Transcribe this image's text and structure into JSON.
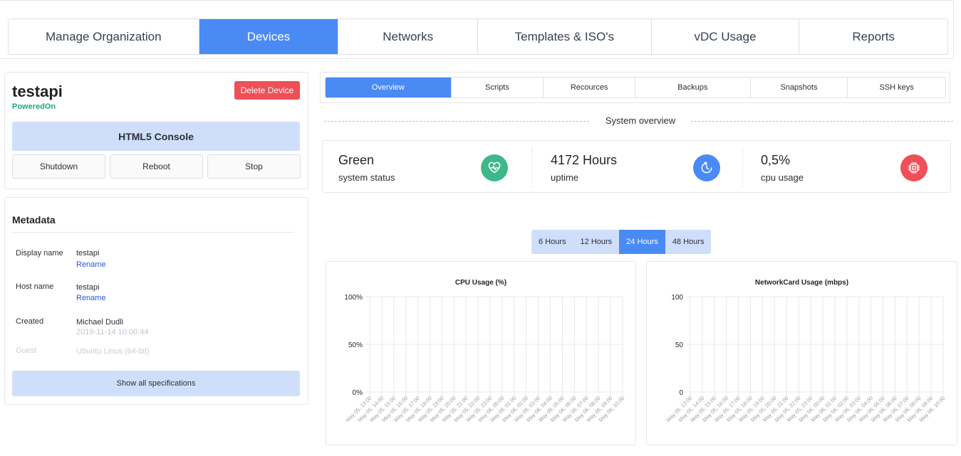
{
  "topnav": {
    "tabs": [
      "Manage Organization",
      "Devices",
      "Networks",
      "Templates & ISO's",
      "vDC Usage",
      "Reports"
    ],
    "active": "Devices"
  },
  "device": {
    "name": "testapi",
    "status": "PoweredOn",
    "delete_label": "Delete Device",
    "console_label": "HTML5 Console",
    "shutdown_label": "Shutdown",
    "reboot_label": "Reboot",
    "stop_label": "Stop"
  },
  "metadata": {
    "title": "Metadata",
    "rows": [
      {
        "label": "Display name",
        "value": "testapi",
        "link": "Rename"
      },
      {
        "label": "Host name",
        "value": "testapi",
        "link": "Rename"
      },
      {
        "label": "Created",
        "value": "Michael Dudli",
        "sub": "2019-11-14 10:00:44"
      },
      {
        "label": "Guest",
        "value": "Ubuntu Linus (64-bit)"
      }
    ],
    "specs_label": "Show all specifications"
  },
  "subtabs": {
    "items": [
      "Overview",
      "Scripts",
      "Recources",
      "Backups",
      "Snapshots",
      "SSH keys"
    ],
    "active": "Overview"
  },
  "overview": {
    "title": "System overview",
    "stats": [
      {
        "value": "Green",
        "label": "system status",
        "icon": "heartbeat-icon",
        "color": "#3db88b"
      },
      {
        "value": "4172 Hours",
        "label": "uptime",
        "icon": "clock-icon",
        "color": "#4a8af4"
      },
      {
        "value": "0,5%",
        "label": "cpu usage",
        "icon": "cpu-chip-icon",
        "color": "#ef4f57"
      }
    ]
  },
  "time_range": {
    "options": [
      "6 Hours",
      "12 Hours",
      "24 Hours",
      "48 Hours"
    ],
    "active": "24 Hours"
  },
  "chart_data": [
    {
      "type": "line",
      "title": "CPU Usage (%)",
      "y_ticks": [
        "100%",
        "50%",
        "0%"
      ],
      "ylim": [
        0,
        100
      ],
      "grid": true,
      "x": [
        "May 05, 13:00",
        "May 05, 14:00",
        "May 05, 15:00",
        "May 05, 16:00",
        "May 05, 17:00",
        "May 05, 18:00",
        "May 05, 19:00",
        "May 05, 20:00",
        "May 05, 21:00",
        "May 05, 22:00",
        "May 05, 23:00",
        "May 06, 00:00",
        "May 06, 01:00",
        "May 06, 02:00",
        "May 06, 03:00",
        "May 06, 04:00",
        "May 06, 05:00",
        "May 06, 06:00",
        "May 06, 07:00",
        "May 06, 08:00",
        "May 06, 09:00",
        "May 06, 10:00"
      ],
      "series": []
    },
    {
      "type": "line",
      "title": "NetworkCard Usage (mbps)",
      "y_ticks": [
        "100",
        "50",
        "0"
      ],
      "ylim": [
        0,
        100
      ],
      "grid": true,
      "x": [
        "May 05, 13:00",
        "May 05, 14:00",
        "May 05, 15:00",
        "May 05, 16:00",
        "May 05, 17:00",
        "May 05, 18:00",
        "May 05, 19:00",
        "May 05, 20:00",
        "May 05, 21:00",
        "May 05, 22:00",
        "May 05, 23:00",
        "May 06, 00:00",
        "May 06, 01:00",
        "May 06, 02:00",
        "May 06, 03:00",
        "May 06, 04:00",
        "May 06, 05:00",
        "May 06, 06:00",
        "May 06, 07:00",
        "May 06, 08:00",
        "May 06, 09:00",
        "May 06, 10:00"
      ],
      "series": []
    }
  ]
}
